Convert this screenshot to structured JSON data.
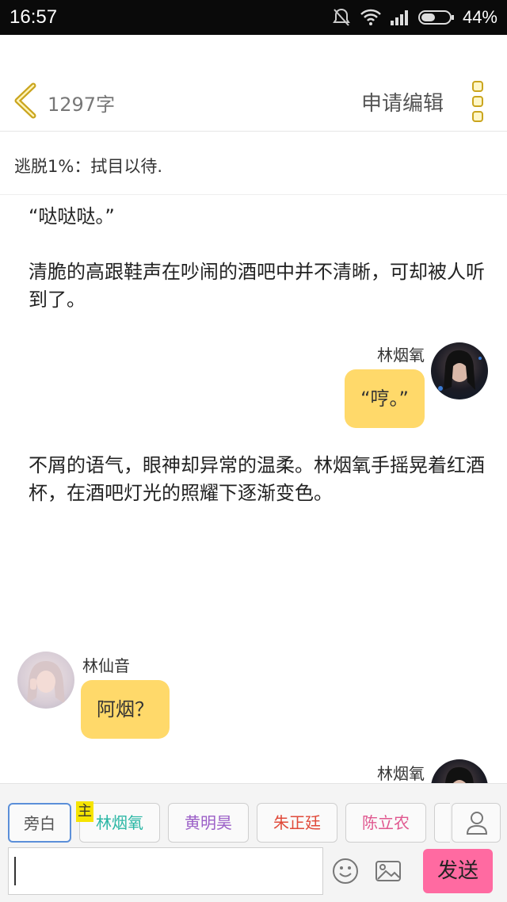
{
  "status_bar": {
    "time": "16:57",
    "battery": "44%"
  },
  "header": {
    "word_count": "1297字",
    "edit_label": "申请编辑"
  },
  "subtitle": "逃脱1%：拭目以待.",
  "story": {
    "narration_1": "“哒哒哒。”",
    "narration_2": "清脆的高跟鞋声在吵闹的酒吧中并不清晰，可却被人听到了。",
    "msg_1": {
      "name": "林烟氧",
      "text": "“哼。”"
    },
    "narration_3": "不屑的语气，眼神却异常的温柔。林烟氧手摇晃着红酒杯，在酒吧灯光的照耀下逐渐变色。",
    "msg_2": {
      "name": "林仙音",
      "text": "阿烟？"
    },
    "msg_3": {
      "name": "林烟氧"
    }
  },
  "roles": {
    "host_tag": "主",
    "items": [
      {
        "label": "旁白",
        "color": "#555555"
      },
      {
        "label": "林烟氧",
        "color": "#2bb7a5"
      },
      {
        "label": "黄明昊",
        "color": "#9b5fc7"
      },
      {
        "label": "朱正廷",
        "color": "#e04a3a"
      },
      {
        "label": "陈立农",
        "color": "#e0578f"
      }
    ]
  },
  "composer": {
    "send_label": "发送"
  },
  "colors": {
    "bubble": "#ffd96a",
    "send": "#ff6aa1",
    "back_arrow": "#caa51e"
  }
}
